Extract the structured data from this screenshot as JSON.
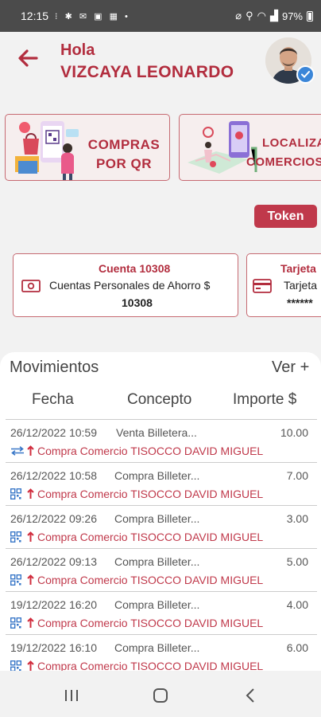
{
  "status_bar": {
    "time": "12:15",
    "battery": "97%"
  },
  "header": {
    "greeting": "Hola",
    "user_name": "VIZCAYA LEONARDO"
  },
  "actions": [
    {
      "label_line1": "COMPRAS",
      "label_line2": "POR QR"
    },
    {
      "label_line1": "LOCALIZA",
      "label_line2": "COMERCIOS"
    }
  ],
  "token_label": "Token",
  "accounts": [
    {
      "title": "Cuenta 10308",
      "desc": "Cuentas Personales de Ahorro $",
      "number": "10308"
    },
    {
      "title": "Tarjeta",
      "desc": "Tarjeta",
      "number": "******"
    }
  ],
  "movements": {
    "title": "Movimientos",
    "more": "Ver +",
    "columns": [
      "Fecha",
      "Concepto",
      "Importe $"
    ],
    "rows": [
      {
        "date": "26/12/2022 10:59",
        "concept": "Venta Billetera...",
        "amount": "10.00",
        "detail": "Compra Comercio TISOCCO DAVID MIGUEL",
        "icon": "transfer-icon"
      },
      {
        "date": "26/12/2022 10:58",
        "concept": "Compra Billeter...",
        "amount": "7.00",
        "detail": "Compra Comercio TISOCCO DAVID MIGUEL",
        "icon": "qr-icon"
      },
      {
        "date": "26/12/2022 09:26",
        "concept": "Compra Billeter...",
        "amount": "3.00",
        "detail": "Compra Comercio TISOCCO DAVID MIGUEL",
        "icon": "qr-icon"
      },
      {
        "date": "26/12/2022 09:13",
        "concept": "Compra Billeter...",
        "amount": "5.00",
        "detail": "Compra Comercio TISOCCO DAVID MIGUEL",
        "icon": "qr-icon"
      },
      {
        "date": "19/12/2022 16:20",
        "concept": "Compra Billeter...",
        "amount": "4.00",
        "detail": "Compra Comercio TISOCCO DAVID MIGUEL",
        "icon": "qr-icon"
      },
      {
        "date": "19/12/2022 16:10",
        "concept": "Compra Billeter...",
        "amount": "6.00",
        "detail": "Compra Comercio TISOCCO DAVID MIGUEL",
        "icon": "qr-icon"
      }
    ]
  },
  "colors": {
    "brand": "#b22d3e",
    "button": "#c0394b",
    "status_bar": "#4b4b4b"
  }
}
